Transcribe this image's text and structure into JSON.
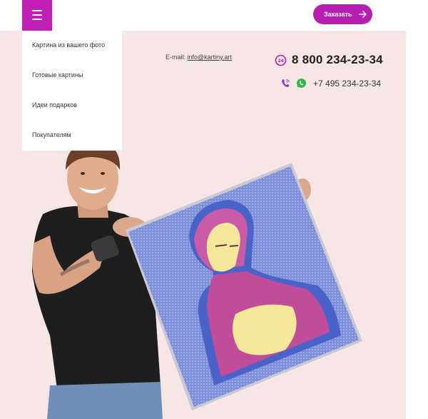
{
  "header": {
    "menu_icon": "hamburger-icon",
    "order_button": {
      "label": "Заказать",
      "icon": "arrow-right-icon"
    }
  },
  "menu": {
    "items": [
      {
        "label": "Картина из вашего фото"
      },
      {
        "label": "Готовые картины"
      },
      {
        "label": "Идеи подарков"
      },
      {
        "label": "Покупателям"
      }
    ]
  },
  "contacts": {
    "email_label": "E-mail:",
    "email": "info@kartiny.art",
    "phone_main": "8 800 234-23-34",
    "phone_main_icon": "phone-24h-icon",
    "phone_secondary": "+7 495 234-23-34",
    "viber_icon": "viber-icon",
    "whatsapp_icon": "whatsapp-icon"
  },
  "hero": {
    "image": "man-holding-pop-art-canvas"
  },
  "colors": {
    "accent": "#c21fb7",
    "hero_background": "#f7e6e6"
  }
}
